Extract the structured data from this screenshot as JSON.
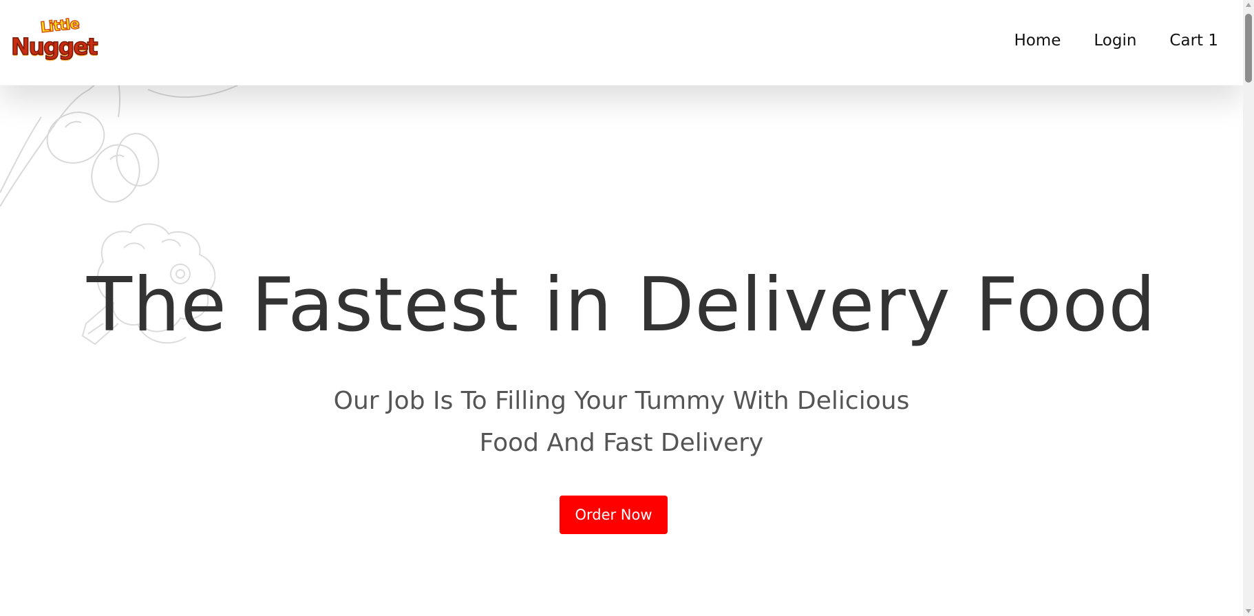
{
  "brand": {
    "logo_top": "Little",
    "logo_main": "Nugget"
  },
  "nav": {
    "items": [
      {
        "label": "Home"
      },
      {
        "label": "Login"
      },
      {
        "label": "Cart 1"
      }
    ]
  },
  "hero": {
    "title": "The Fastest in Delivery Food",
    "subtitle": "Our Job Is To Filling Your Tummy With Delicious Food And Fast Delivery",
    "cta_label": "Order Now"
  },
  "colors": {
    "accent": "#ff0000",
    "title_text": "#333333",
    "subtitle_text": "#555555",
    "nav_text": "#111111"
  },
  "icons": {
    "background": [
      "grapes-doodle-icon",
      "broccoli-doodle-icon"
    ],
    "scrollbar": [
      "scroll-up-arrow-icon",
      "scroll-down-arrow-icon"
    ]
  }
}
